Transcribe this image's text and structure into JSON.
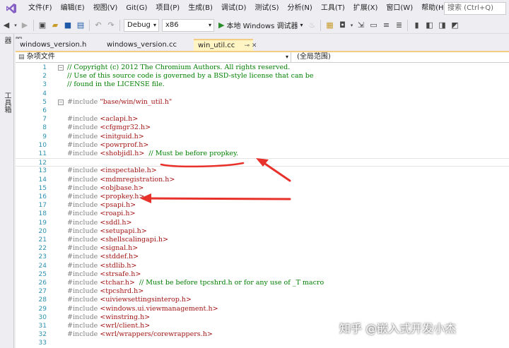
{
  "menu": {
    "items": [
      "文件(F)",
      "编辑(E)",
      "视图(V)",
      "Git(G)",
      "项目(P)",
      "生成(B)",
      "调试(D)",
      "测试(S)",
      "分析(N)",
      "工具(T)",
      "扩展(X)",
      "窗口(W)",
      "帮助(H)"
    ],
    "search_placeholder": "搜索 (Ctrl+Q)"
  },
  "toolbar": {
    "config": "Debug",
    "platform": "x86",
    "run_label": "本地 Windows 调试器"
  },
  "side_panel": {
    "tabs": [
      "服务器资源管理器",
      "工具箱"
    ]
  },
  "tabs": [
    {
      "label": "windows_version.h",
      "active": false
    },
    {
      "label": "windows_version.cc",
      "active": false
    },
    {
      "label": "win_util.cc",
      "active": true
    }
  ],
  "navbar": {
    "file_scope": "杂项文件",
    "global_scope": "(全局范围)"
  },
  "code_lines": [
    {
      "n": "1",
      "parts": [
        [
          "c",
          "// Copyright (c) 2012 The Chromium Authors. All rights reserved."
        ]
      ]
    },
    {
      "n": "2",
      "parts": [
        [
          "c",
          "// Use of this source code is governed by a BSD-style license that can be"
        ]
      ]
    },
    {
      "n": "3",
      "parts": [
        [
          "c",
          "// found in the LICENSE file."
        ]
      ]
    },
    {
      "n": "4",
      "parts": []
    },
    {
      "n": "5",
      "parts": [
        [
          "p",
          "#include "
        ],
        [
          "s",
          "\"base/win/win_util.h\""
        ]
      ]
    },
    {
      "n": "6",
      "parts": []
    },
    {
      "n": "7",
      "parts": [
        [
          "p",
          "#include "
        ],
        [
          "s",
          "<aclapi.h>"
        ]
      ]
    },
    {
      "n": "8",
      "parts": [
        [
          "p",
          "#include "
        ],
        [
          "s",
          "<cfgmgr32.h>"
        ]
      ]
    },
    {
      "n": "9",
      "parts": [
        [
          "p",
          "#include "
        ],
        [
          "s",
          "<initguid.h>"
        ]
      ]
    },
    {
      "n": "10",
      "parts": [
        [
          "p",
          "#include "
        ],
        [
          "s",
          "<powrprof.h>"
        ]
      ]
    },
    {
      "n": "11",
      "parts": [
        [
          "p",
          "#include "
        ],
        [
          "s",
          "<shobjidl.h>"
        ],
        [
          "t",
          "  "
        ],
        [
          "c",
          "// Must be before propkey."
        ]
      ]
    },
    {
      "n": "12",
      "parts": []
    },
    {
      "n": "13",
      "parts": [
        [
          "p",
          "#include "
        ],
        [
          "s",
          "<inspectable.h>"
        ]
      ]
    },
    {
      "n": "14",
      "parts": [
        [
          "p",
          "#include "
        ],
        [
          "s",
          "<mdmregistration.h>"
        ]
      ]
    },
    {
      "n": "15",
      "parts": [
        [
          "p",
          "#include "
        ],
        [
          "s",
          "<objbase.h>"
        ]
      ]
    },
    {
      "n": "16",
      "parts": [
        [
          "p",
          "#include "
        ],
        [
          "s",
          "<propkey.h>"
        ]
      ]
    },
    {
      "n": "17",
      "parts": [
        [
          "p",
          "#include "
        ],
        [
          "s",
          "<psapi.h>"
        ]
      ]
    },
    {
      "n": "18",
      "parts": [
        [
          "p",
          "#include "
        ],
        [
          "s",
          "<roapi.h>"
        ]
      ]
    },
    {
      "n": "19",
      "parts": [
        [
          "p",
          "#include "
        ],
        [
          "s",
          "<sddl.h>"
        ]
      ]
    },
    {
      "n": "20",
      "parts": [
        [
          "p",
          "#include "
        ],
        [
          "s",
          "<setupapi.h>"
        ]
      ]
    },
    {
      "n": "21",
      "parts": [
        [
          "p",
          "#include "
        ],
        [
          "s",
          "<shellscalingapi.h>"
        ]
      ]
    },
    {
      "n": "22",
      "parts": [
        [
          "p",
          "#include "
        ],
        [
          "s",
          "<signal.h>"
        ]
      ]
    },
    {
      "n": "23",
      "parts": [
        [
          "p",
          "#include "
        ],
        [
          "s",
          "<stddef.h>"
        ]
      ]
    },
    {
      "n": "24",
      "parts": [
        [
          "p",
          "#include "
        ],
        [
          "s",
          "<stdlib.h>"
        ]
      ]
    },
    {
      "n": "25",
      "parts": [
        [
          "p",
          "#include "
        ],
        [
          "s",
          "<strsafe.h>"
        ]
      ]
    },
    {
      "n": "26",
      "parts": [
        [
          "p",
          "#include "
        ],
        [
          "s",
          "<tchar.h>"
        ],
        [
          "t",
          "  "
        ],
        [
          "c",
          "// Must be before tpcshrd.h or for any use of _T macro"
        ]
      ]
    },
    {
      "n": "27",
      "parts": [
        [
          "p",
          "#include "
        ],
        [
          "s",
          "<tpcshrd.h>"
        ]
      ]
    },
    {
      "n": "28",
      "parts": [
        [
          "p",
          "#include "
        ],
        [
          "s",
          "<uiviewsettingsinterop.h>"
        ]
      ]
    },
    {
      "n": "29",
      "parts": [
        [
          "p",
          "#include "
        ],
        [
          "s",
          "<windows.ui.viewmanagement.h>"
        ]
      ]
    },
    {
      "n": "30",
      "parts": [
        [
          "p",
          "#include "
        ],
        [
          "s",
          "<winstring.h>"
        ]
      ]
    },
    {
      "n": "31",
      "parts": [
        [
          "p",
          "#include "
        ],
        [
          "s",
          "<wrl/client.h>"
        ]
      ]
    },
    {
      "n": "32",
      "parts": [
        [
          "p",
          "#include "
        ],
        [
          "s",
          "<wrl/wrappers/corewrappers.h>"
        ]
      ]
    },
    {
      "n": "33",
      "parts": []
    }
  ],
  "watermark": "知乎 @嵌入式开发小杰",
  "colors": {
    "annotation": "#e8312a",
    "comment": "#008000",
    "string": "#a31515",
    "line_number": "#2b91af"
  }
}
